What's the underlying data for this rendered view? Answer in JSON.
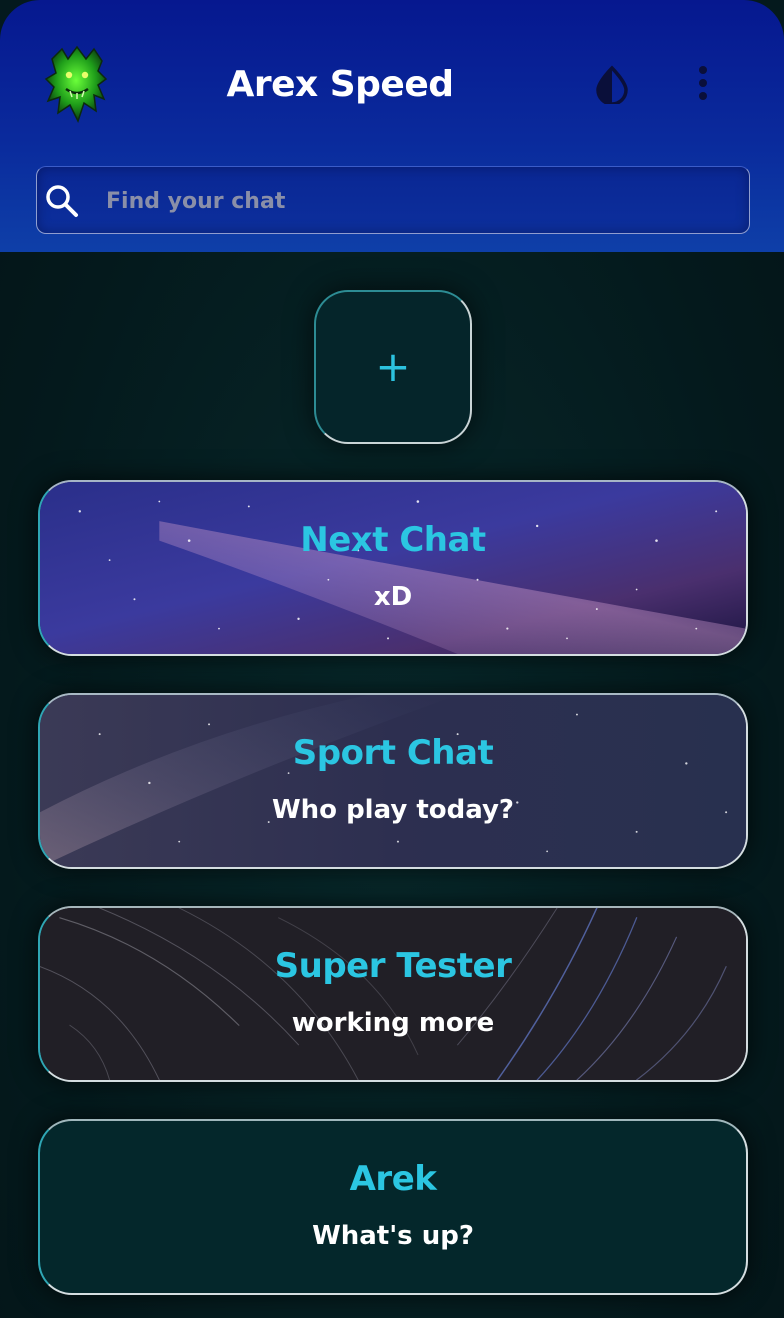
{
  "header": {
    "title": "Arex Speed",
    "logo_icon": "green-demon-logo-icon",
    "theme_icon": "contrast-drop-icon",
    "menu_icon": "more-vertical-icon"
  },
  "search": {
    "placeholder": "Find your chat",
    "value": ""
  },
  "add_button": {
    "label": "+"
  },
  "chats": [
    {
      "name": "Next Chat",
      "message": "xD",
      "background": "galaxy-milky-way"
    },
    {
      "name": "Sport Chat",
      "message": "Who play today?",
      "background": "starry-nebula"
    },
    {
      "name": "Super Tester",
      "message": "working more",
      "background": "star-trails"
    },
    {
      "name": "Arek",
      "message": "What's up?",
      "background": "plain-dark-teal"
    }
  ],
  "colors": {
    "header": "#0a2a9c",
    "background": "#04191d",
    "accent": "#2bc6e2",
    "text": "#ffffff"
  }
}
